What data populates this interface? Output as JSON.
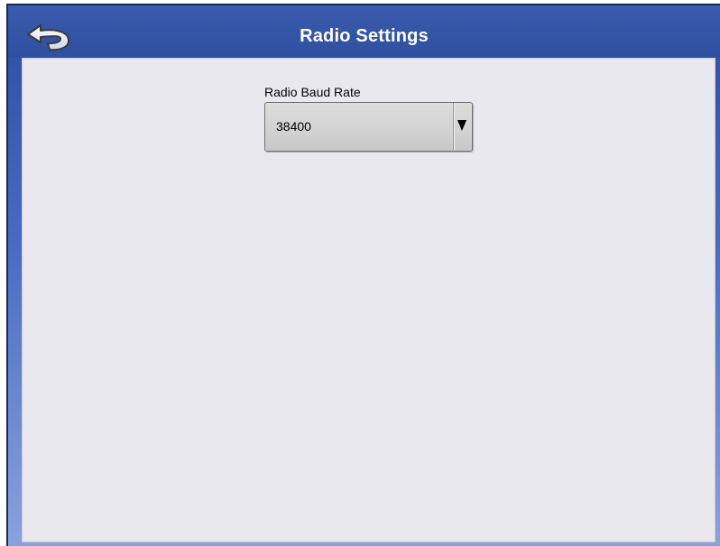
{
  "window": {
    "title": "Radio Settings"
  },
  "header": {
    "back_icon": "back-arrow-icon"
  },
  "form": {
    "baud_rate": {
      "label": "Radio Baud Rate",
      "value": "38400",
      "arrow_icon": "dropdown-arrow-icon"
    }
  },
  "colors": {
    "title_bar": "#2f4f9f",
    "content_bg": "#e9e8ef",
    "dropdown_bg": "#d2d2d2"
  }
}
